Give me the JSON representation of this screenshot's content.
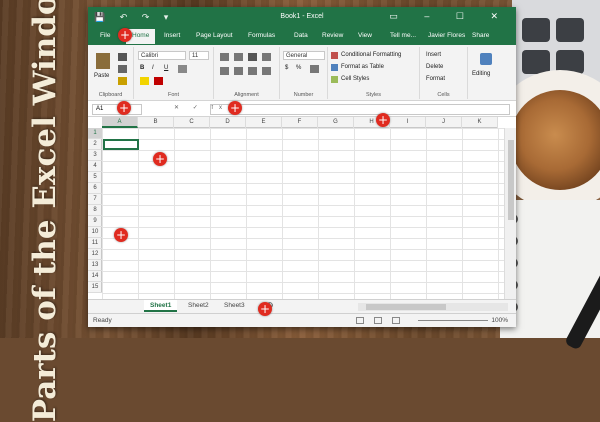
{
  "side_title": "Parts of the Excel Window",
  "titlebar": {
    "title": "Book1 - Excel",
    "qat": "💾 ↶ ↷ ▾",
    "controls": "▭ – ☐ ✕"
  },
  "tabs": [
    "File",
    "Home",
    "Insert",
    "Page Layout",
    "Formulas",
    "Data",
    "Review",
    "View"
  ],
  "active_tab": "Home",
  "tell_me": "Tell me...",
  "user": "Javier Flores",
  "share": "Share",
  "ribbon": {
    "groups": [
      "Clipboard",
      "Font",
      "Alignment",
      "Number",
      "Styles",
      "Cells",
      "Editing"
    ],
    "paste": "Paste",
    "font_name": "Calibri",
    "font_size": "11",
    "number_format": "General",
    "conditional_formatting": "Conditional Formatting",
    "format_as_table": "Format as Table",
    "cell_styles": "Cell Styles",
    "insert": "Insert",
    "delete": "Delete",
    "format": "Format",
    "editing": "Editing",
    "bold": "B",
    "italic": "I",
    "underline": "U",
    "currency": "$",
    "percent": "%"
  },
  "formula_bar": {
    "name_box": "A1",
    "fx": "✕ ✓ fx"
  },
  "columns": [
    "A",
    "B",
    "C",
    "D",
    "E",
    "F",
    "G",
    "H",
    "I",
    "J",
    "K"
  ],
  "rows": [
    "1",
    "2",
    "3",
    "4",
    "5",
    "6",
    "7",
    "8",
    "9",
    "10",
    "11",
    "12",
    "13",
    "14",
    "15"
  ],
  "selected_cell": {
    "column": "A",
    "row": "1"
  },
  "sheets": [
    "Sheet1",
    "Sheet2",
    "Sheet3"
  ],
  "active_sheet": "Sheet1",
  "status": {
    "ready": "Ready",
    "zoom": "100%"
  },
  "colors": {
    "excel_green": "#217346",
    "marker_red": "#e02b20"
  },
  "markers": [
    {
      "name": "marker-file-tab",
      "symbol": "+"
    },
    {
      "name": "marker-name-box",
      "symbol": "+"
    },
    {
      "name": "marker-formula-bar",
      "symbol": "+"
    },
    {
      "name": "marker-column-header",
      "symbol": "+"
    },
    {
      "name": "marker-cell",
      "symbol": "+"
    },
    {
      "name": "marker-row-header",
      "symbol": "+"
    },
    {
      "name": "marker-sheet-tabs",
      "symbol": "+"
    }
  ]
}
